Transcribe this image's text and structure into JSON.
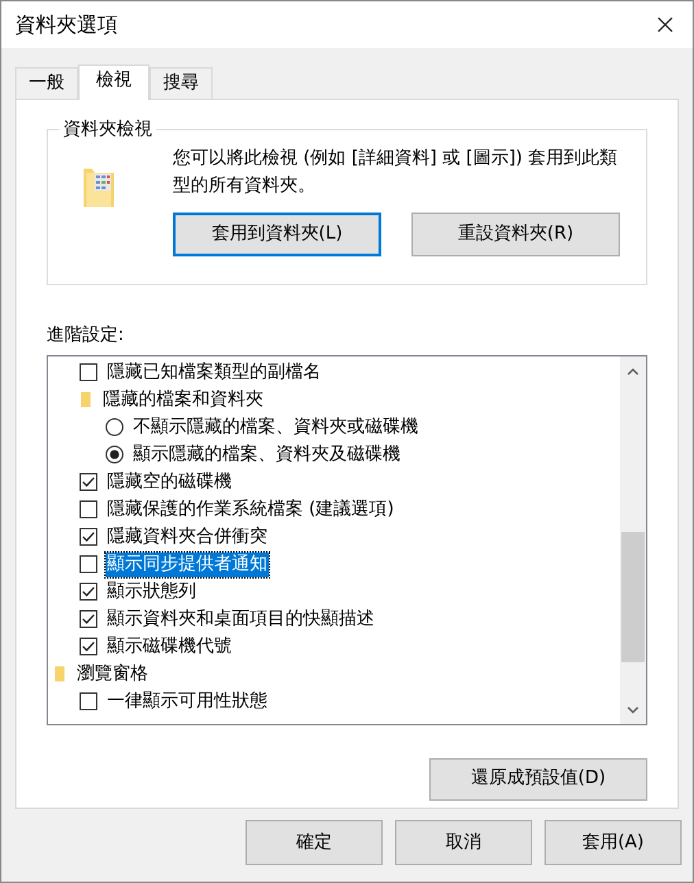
{
  "window": {
    "title": "資料夾選項"
  },
  "tabs": [
    {
      "label": "一般",
      "selected": false
    },
    {
      "label": "檢視",
      "selected": true
    },
    {
      "label": "搜尋",
      "selected": false
    }
  ],
  "folder_views": {
    "title": "資料夾檢視",
    "description": "您可以將此檢視 (例如 [詳細資料] 或 [圖示]) 套用到此類型的所有資料夾。",
    "buttons": [
      {
        "label": "套用到資料夾(L)",
        "focused": true
      },
      {
        "label": "重設資料夾(R)",
        "focused": false
      }
    ]
  },
  "advanced": {
    "label": "進階設定:",
    "items": [
      {
        "kind": "continued",
        "children": [
          {
            "kind": "checkbox",
            "label": "隱藏已知檔案類型的副檔名",
            "checked": false,
            "selected": false
          },
          {
            "kind": "folder",
            "label": "隱藏的檔案和資料夾",
            "selected": false,
            "children": [
              {
                "kind": "radio",
                "label": "不顯示隱藏的檔案、資料夾或磁碟機",
                "checked": false,
                "selected": false
              },
              {
                "kind": "radio",
                "label": "顯示隱藏的檔案、資料夾及磁碟機",
                "checked": true,
                "selected": false
              }
            ]
          },
          {
            "kind": "checkbox",
            "label": "隱藏空的磁碟機",
            "checked": true,
            "selected": false
          },
          {
            "kind": "checkbox",
            "label": "隱藏保護的作業系統檔案 (建議選項)",
            "checked": false,
            "selected": false
          },
          {
            "kind": "checkbox",
            "label": "隱藏資料夾合併衝突",
            "checked": true,
            "selected": false
          },
          {
            "kind": "checkbox",
            "label": "顯示同步提供者通知",
            "checked": false,
            "selected": true
          },
          {
            "kind": "checkbox",
            "label": "顯示狀態列",
            "checked": true,
            "selected": false
          },
          {
            "kind": "checkbox",
            "label": "顯示資料夾和桌面項目的快顯描述",
            "checked": true,
            "selected": false
          },
          {
            "kind": "checkbox",
            "label": "顯示磁碟機代號",
            "checked": true,
            "selected": false
          }
        ]
      },
      {
        "kind": "folder",
        "label": "瀏覽窗格",
        "selected": false,
        "children": [
          {
            "kind": "checkbox",
            "label": "一律顯示可用性狀態",
            "checked": false,
            "selected": false
          }
        ]
      }
    ]
  },
  "restore_button": "還原成預設值(D)",
  "buttons": [
    "確定",
    "取消",
    "套用(A)"
  ]
}
